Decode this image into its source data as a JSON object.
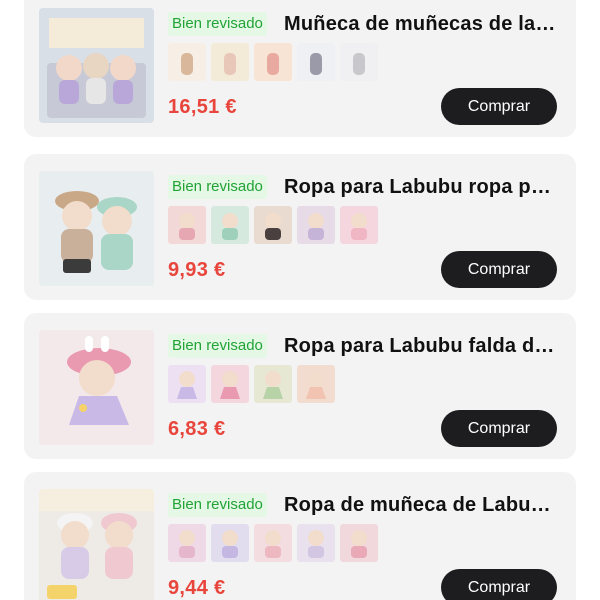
{
  "products": [
    {
      "badge": "Bien revisado",
      "title": "Muñeca de muñecas de labubu",
      "price": "16,51 €",
      "buy_label": "Comprar",
      "thumb_count": 5,
      "image_colors": {
        "bg": "#d9dfe6",
        "accent": "#b8a7d8",
        "accent2": "#f2d8c9"
      },
      "thumb_colors": [
        "#f7efe6",
        "#f4ead8",
        "#f8e4d4",
        "#eef0f4",
        "#f0f0f2"
      ]
    },
    {
      "badge": "Bien revisado",
      "title": "Ropa para Labubu ropa para muñecas",
      "price": "9,93 €",
      "buy_label": "Comprar",
      "thumb_count": 5,
      "image_colors": {
        "bg": "#e8eef0",
        "accent": "#c9a888",
        "accent2": "#a9d6c6"
      },
      "thumb_colors": [
        "#f3d8d8",
        "#d6e9df",
        "#eadbd0",
        "#e7dbe8",
        "#f6d6de"
      ]
    },
    {
      "badge": "Bien revisado",
      "title": "Ropa para Labubu falda de muñeca",
      "price": "6,83 €",
      "buy_label": "Comprar",
      "thumb_count": 4,
      "image_colors": {
        "bg": "#f3e8ea",
        "accent": "#e99ab0",
        "accent2": "#c9b9e6"
      },
      "thumb_colors": [
        "#ede0f2",
        "#f4d6de",
        "#e6e8d4",
        "#f2dcd0"
      ]
    },
    {
      "badge": "Bien revisado",
      "title": "Ropa de muñeca de Labubu vestido",
      "price": "9,44 €",
      "buy_label": "Comprar",
      "thumb_count": 5,
      "image_colors": {
        "bg": "#eeeae6",
        "accent": "#f0c8cf",
        "accent2": "#d7cbe8"
      },
      "thumb_colors": [
        "#efd9e6",
        "#e2dcef",
        "#f3dde0",
        "#e9e2ee",
        "#f1d8dc"
      ]
    }
  ]
}
